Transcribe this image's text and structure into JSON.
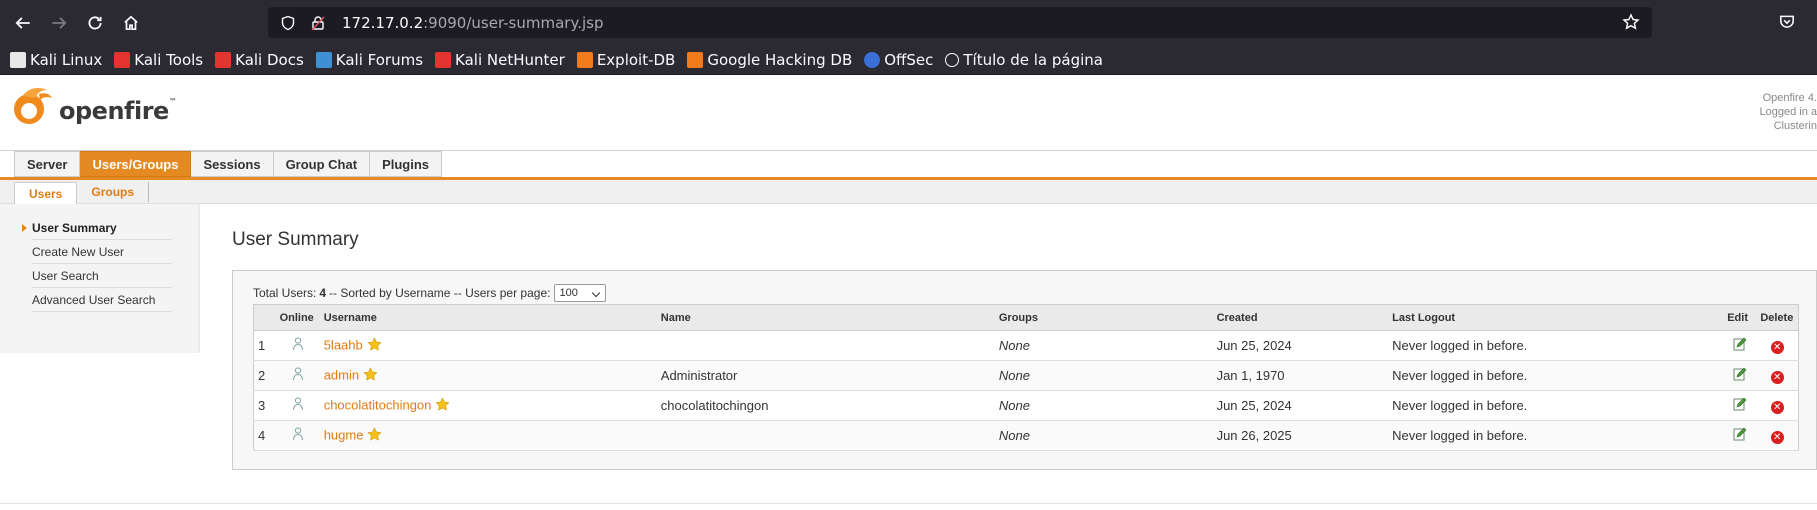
{
  "browser": {
    "url_host": "172.17.0.2",
    "url_rest": ":9090/user-summary.jsp",
    "bookmarks": [
      {
        "label": "Kali Linux",
        "icon": "kali-dragon-icon",
        "color": "#e8e8e8"
      },
      {
        "label": "Kali Tools",
        "icon": "kali-tools-icon",
        "color": "#e3342f"
      },
      {
        "label": "Kali Docs",
        "icon": "kali-docs-icon",
        "color": "#e3342f"
      },
      {
        "label": "Kali Forums",
        "icon": "kali-forums-icon",
        "color": "#3d8fd6"
      },
      {
        "label": "Kali NetHunter",
        "icon": "nethunter-icon",
        "color": "#e3342f"
      },
      {
        "label": "Exploit-DB",
        "icon": "exploit-db-icon",
        "color": "#f07b1a"
      },
      {
        "label": "Google Hacking DB",
        "icon": "ghdb-icon",
        "color": "#f07b1a"
      },
      {
        "label": "OffSec",
        "icon": "offsec-icon",
        "color": "#3b6ed6"
      },
      {
        "label": "Título de la página",
        "icon": "globe-icon",
        "color": "#fbfbfe"
      }
    ]
  },
  "header": {
    "logo_text": "openfire",
    "info_lines": [
      "Openfire 4.",
      "Logged in a",
      "Clusterin"
    ]
  },
  "tabs": [
    "Server",
    "Users/Groups",
    "Sessions",
    "Group Chat",
    "Plugins"
  ],
  "active_tab": "Users/Groups",
  "subtabs": [
    "Users",
    "Groups"
  ],
  "sidebar": [
    "User Summary",
    "Create New User",
    "User Search",
    "Advanced User Search"
  ],
  "page_title": "User Summary",
  "summary": {
    "prefix": "Total Users:",
    "count": "4",
    "suffix": "-- Sorted by Username -- Users per page:",
    "per_page": "100"
  },
  "table": {
    "headers": [
      "",
      "Online",
      "Username",
      "Name",
      "Groups",
      "Created",
      "Last Logout",
      "Edit",
      "Delete"
    ],
    "rows": [
      {
        "num": "1",
        "username": "5laahb",
        "name": "",
        "groups": "None",
        "created": "Jun 25, 2024",
        "last_logout": "Never logged in before."
      },
      {
        "num": "2",
        "username": "admin",
        "name": "Administrator",
        "groups": "None",
        "created": "Jan 1, 1970",
        "last_logout": "Never logged in before."
      },
      {
        "num": "3",
        "username": "chocolatitochingon",
        "name": "chocolatitochingon",
        "groups": "None",
        "created": "Jun 25, 2024",
        "last_logout": "Never logged in before."
      },
      {
        "num": "4",
        "username": "hugme",
        "name": "",
        "groups": "None",
        "created": "Jun 26, 2025",
        "last_logout": "Never logged in before."
      }
    ]
  },
  "colors": {
    "accent": "#e58a22",
    "link": "#e07c12",
    "delete": "#d81e1e"
  }
}
